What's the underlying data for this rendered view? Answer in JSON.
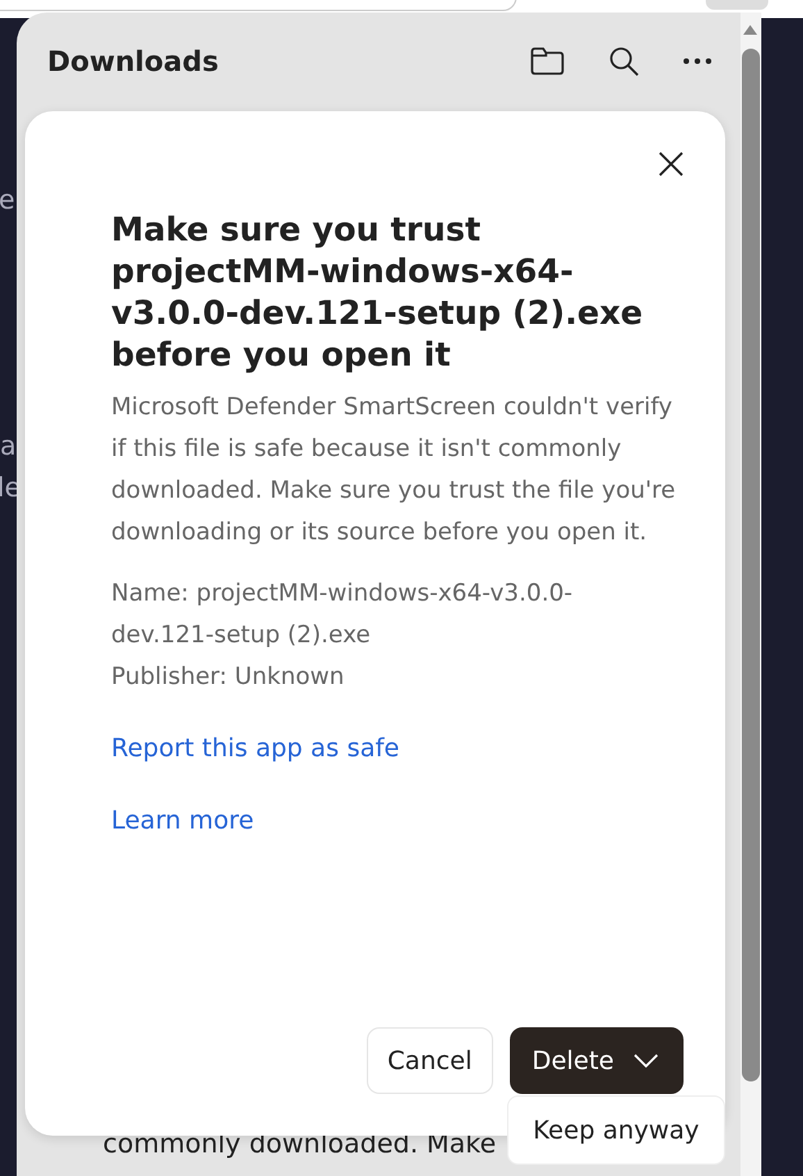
{
  "background_text": [
    "e",
    "a",
    "le"
  ],
  "panel": {
    "title": "Downloads",
    "behind_text": "commonly downloaded. Make"
  },
  "dialog": {
    "title": "Make sure you trust projectMM-windows-x64-v3.0.0-dev.121-setup (2).exe before you open it",
    "message": "Microsoft Defender SmartScreen couldn't verify if this file is safe because it isn't commonly downloaded. Make sure you trust the file you're downloading or its source before you open it.",
    "details": [
      "Name: projectMM-windows-x64-v3.0.0-dev.121-setup (2).exe",
      "Publisher: Unknown"
    ],
    "links": [
      "Report this app as safe",
      "Learn more"
    ],
    "buttons": [
      {
        "label": "Cancel",
        "kind": "secondary"
      },
      {
        "label": "Delete",
        "kind": "split"
      }
    ],
    "menu": [
      {
        "label": "Keep anyway"
      }
    ]
  }
}
